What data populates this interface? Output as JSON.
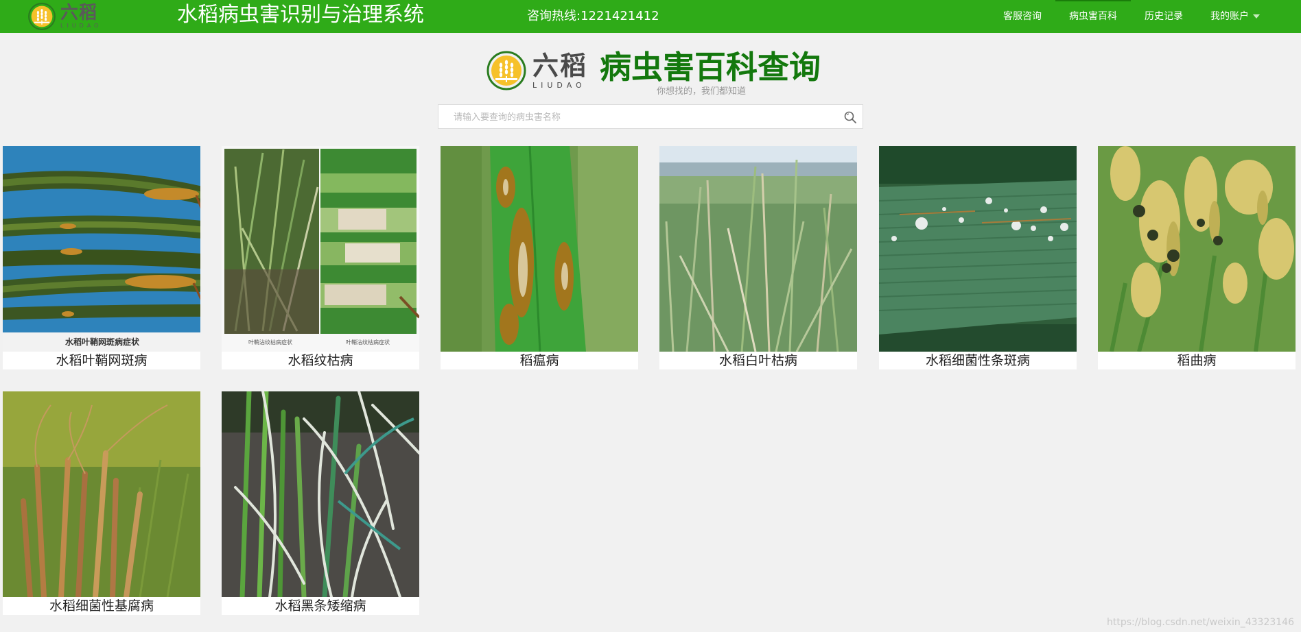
{
  "brand": {
    "name_cn": "六稻",
    "name_en": "LIUDAO"
  },
  "header": {
    "title": "水稻病虫害识别与治理系统",
    "hotline": "咨询热线:1221421412",
    "nav": [
      {
        "label": "客服咨询",
        "active": false
      },
      {
        "label": "病虫害百科",
        "active": true
      },
      {
        "label": "历史记录",
        "active": false
      },
      {
        "label": "我的账户",
        "active": false,
        "dropdown": true
      }
    ]
  },
  "hero": {
    "title": "病虫害百科查询",
    "subtitle": "你想找的，我们都知道"
  },
  "search": {
    "placeholder": "请输入要查询的病虫害名称",
    "value": ""
  },
  "diseases": [
    {
      "name": "水稻叶鞘网斑病",
      "image_caption": "水稻叶鞘网斑病症状"
    },
    {
      "name": "水稻纹枯病",
      "image_caption_left": "叶鞘沾纹枯病症状",
      "image_caption_right": "叶鞘沾纹枯病症状"
    },
    {
      "name": "稻瘟病"
    },
    {
      "name": "水稻白叶枯病"
    },
    {
      "name": "水稻细菌性条斑病"
    },
    {
      "name": "稻曲病"
    },
    {
      "name": "水稻细菌性基腐病"
    },
    {
      "name": "水稻黑条矮缩病"
    }
  ],
  "colors": {
    "header_bg": "#2fab18",
    "title_green": "#13780d",
    "page_bg": "#f1f1f1"
  },
  "watermark": "https://blog.csdn.net/weixin_43323146"
}
